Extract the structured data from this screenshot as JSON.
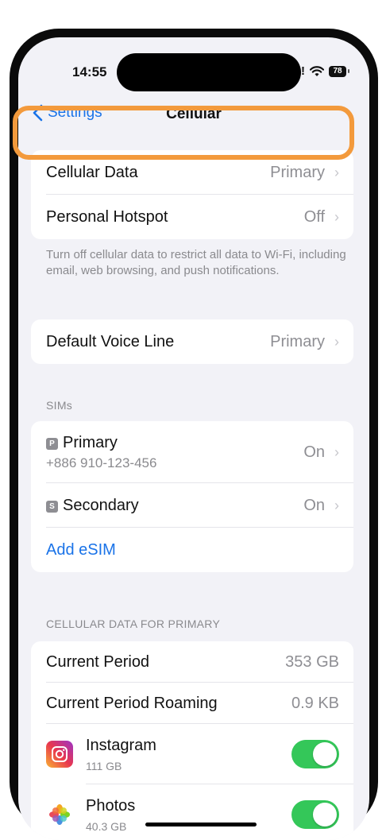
{
  "status": {
    "time": "14:55",
    "signal_text": "!",
    "battery": "78"
  },
  "nav": {
    "back_label": "Settings",
    "title": "Cellular"
  },
  "group1": {
    "cellular_data": {
      "label": "Cellular Data",
      "value": "Primary"
    },
    "personal_hotspot": {
      "label": "Personal Hotspot",
      "value": "Off"
    }
  },
  "note": "Turn off cellular data to restrict all data to Wi-Fi, including email, web browsing, and push notifications.",
  "voice": {
    "label": "Default Voice Line",
    "value": "Primary"
  },
  "sims": {
    "header": "SIMs",
    "primary": {
      "badge": "P",
      "label": "Primary",
      "number": "+886 910-123-456",
      "value": "On"
    },
    "secondary": {
      "badge": "S",
      "label": "Secondary",
      "value": "On"
    },
    "add_esim": "Add eSIM"
  },
  "usage": {
    "header": "CELLULAR DATA FOR PRIMARY",
    "current_period": {
      "label": "Current Period",
      "value": "353 GB"
    },
    "current_period_roaming": {
      "label": "Current Period Roaming",
      "value": "0.9 KB"
    },
    "apps": [
      {
        "name": "Instagram",
        "size": "111 GB",
        "enabled": true
      },
      {
        "name": "Photos",
        "size": "40.3 GB",
        "enabled": true
      }
    ]
  },
  "colors": {
    "accent": "#1a73e8",
    "toggle_on": "#34c759",
    "highlight": "#f39a3c"
  },
  "icons": [
    "chevron-left-icon",
    "chevron-right-icon",
    "wifi-icon",
    "battery-icon",
    "instagram-icon",
    "photos-icon"
  ]
}
